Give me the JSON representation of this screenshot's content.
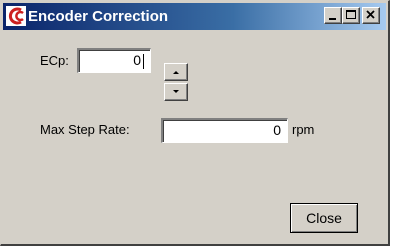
{
  "window": {
    "title": "Encoder Correction",
    "icon": "app-logo-icon",
    "controls": {
      "minimize_icon": "minimize-icon",
      "maximize_icon": "maximize-icon",
      "close_icon": "close-icon"
    }
  },
  "form": {
    "ecp": {
      "label": "ECp:",
      "value": "0",
      "spin_up_icon": "arrow-up-icon",
      "spin_down_icon": "arrow-down-icon"
    },
    "max_step_rate": {
      "label": "Max Step Rate:",
      "value": "0",
      "unit": "rpm"
    }
  },
  "actions": {
    "close_label": "Close"
  },
  "colors": {
    "titlebar_start": "#0a246a",
    "titlebar_end": "#a6caf0",
    "face": "#d4d0c8",
    "app_icon": "#cc2020"
  }
}
